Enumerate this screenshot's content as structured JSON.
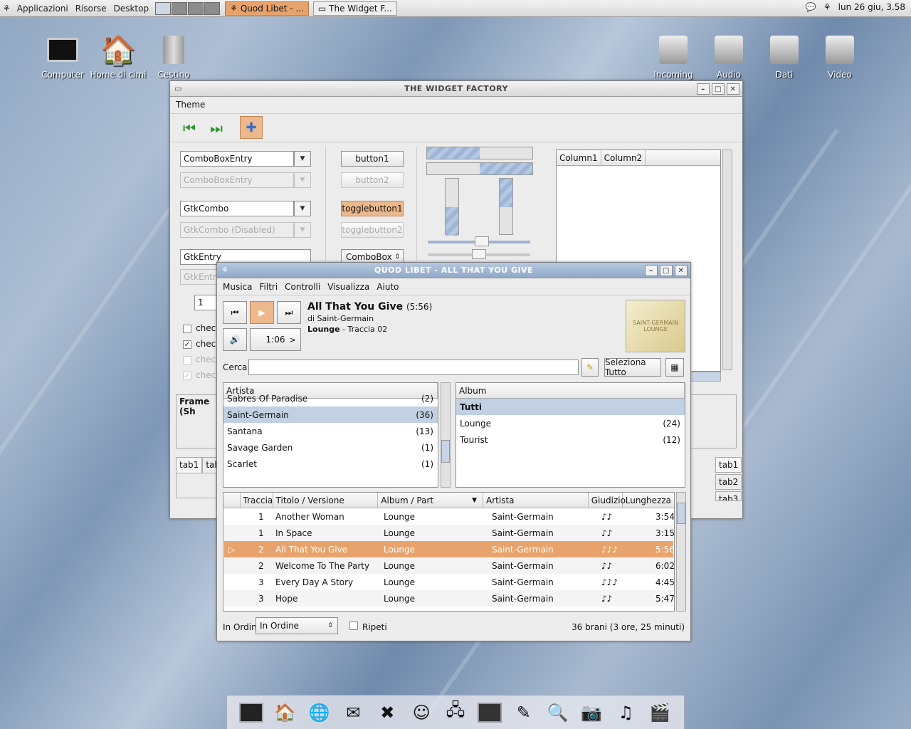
{
  "topbar": {
    "menus": [
      "Applicazioni",
      "Risorse",
      "Desktop"
    ],
    "tasks": [
      {
        "label": "Quod Libet - ...",
        "active": true
      },
      {
        "label": "The Widget F...",
        "active": false
      }
    ],
    "clock": "lun 26 giu,  3.58"
  },
  "desktop_icons": [
    {
      "label": "Computer",
      "icon": "monitor-icon"
    },
    {
      "label": "Home di cimi",
      "icon": "home-icon"
    },
    {
      "label": "Cestino",
      "icon": "trash-icon"
    },
    {
      "label": "Incoming",
      "icon": "drive-icon"
    },
    {
      "label": "Audio",
      "icon": "drive-icon"
    },
    {
      "label": "Dati",
      "icon": "drive-icon"
    },
    {
      "label": "Video",
      "icon": "drive-icon"
    }
  ],
  "widget_factory": {
    "title": "THE WIDGET FACTORY",
    "menu": "Theme",
    "combo1": "ComboBoxEntry",
    "combo1_dis": "ComboBoxEntry",
    "gtkcombo": "GtkCombo",
    "gtkcombo_dis": "GtkCombo (Disabled)",
    "entry": "GtkEntry",
    "entry_dis": "GtkEntry",
    "spin": "1",
    "checks": [
      "check",
      "check",
      "check",
      "check"
    ],
    "button1": "button1",
    "button2": "button2",
    "toggle1": "togglebutton1",
    "toggle2": "togglebutton2",
    "combobox": "ComboBox",
    "col1": "Column1",
    "col2": "Column2",
    "frame": "Frame (Sh",
    "tabs_left": [
      "tab1",
      "tab2"
    ],
    "tabs_right": [
      "tab1",
      "tab2",
      "tab3"
    ]
  },
  "quodlibet": {
    "title": "QUOD LIBET - ALL THAT YOU GIVE",
    "menus": [
      "Musica",
      "Filtri",
      "Controlli",
      "Visualizza",
      "Aiuto"
    ],
    "song_title": "All That You Give",
    "song_length": "(5:56)",
    "artist_line": "di Saint-Germain",
    "album": "Lounge",
    "track_line": " - Traccia 02",
    "time": "1:06",
    "time_arrow": ">",
    "cover_text": "SAINT-GERMAIN LOUNGE",
    "search_label": "Cerca:",
    "search_value": "",
    "select_all": "Seleziona Tutto",
    "artist_header": "Artista",
    "artists": [
      {
        "name": "Sabres Of Paradise",
        "count": "(2)"
      },
      {
        "name": "Saint-Germain",
        "count": "(36)",
        "selected": true
      },
      {
        "name": "Santana",
        "count": "(13)"
      },
      {
        "name": "Savage Garden",
        "count": "(1)"
      },
      {
        "name": "Scarlet",
        "count": "(1)"
      }
    ],
    "album_header": "Album",
    "albums": [
      {
        "name": "Tutti",
        "count": "",
        "selected": true
      },
      {
        "name": "Lounge",
        "count": "(24)"
      },
      {
        "name": "Tourist",
        "count": "(12)"
      }
    ],
    "columns": [
      "Traccia",
      "Titolo / Versione",
      "Album / Part",
      "Artista",
      "Giudizio",
      "Lunghezza"
    ],
    "tracks": [
      {
        "n": "1",
        "title": "Another Woman",
        "album": "Lounge",
        "artist": "Saint-Germain",
        "rating": "♪♪",
        "len": "3:54"
      },
      {
        "n": "1",
        "title": "In Space",
        "album": "Lounge",
        "artist": "Saint-Germain",
        "rating": "♪♪",
        "len": "3:15"
      },
      {
        "n": "2",
        "title": "All That You Give",
        "album": "Lounge",
        "artist": "Saint-Germain",
        "rating": "♪♪♪",
        "len": "5:56",
        "playing": true
      },
      {
        "n": "2",
        "title": "Welcome To The Party",
        "album": "Lounge",
        "artist": "Saint-Germain",
        "rating": "♪♪",
        "len": "6:02"
      },
      {
        "n": "3",
        "title": "Every Day A Story",
        "album": "Lounge",
        "artist": "Saint-Germain",
        "rating": "♪♪♪",
        "len": "4:45"
      },
      {
        "n": "3",
        "title": "Hope",
        "album": "Lounge",
        "artist": "Saint-Germain",
        "rating": "♪♪",
        "len": "5:47"
      }
    ],
    "order_label": "In Ordine",
    "order_value": "In Ordine",
    "repeat_label": "Ripeti",
    "status": "36 brani (3 ore, 25 minuti)"
  },
  "dock_icons": [
    "terminal-icon",
    "home-icon",
    "globe-icon",
    "mail-icon",
    "chat-icon",
    "messenger-icon",
    "network-icon",
    "monitor-icon",
    "editor-icon",
    "search-icon",
    "camera-icon",
    "music-icon",
    "video-icon"
  ]
}
